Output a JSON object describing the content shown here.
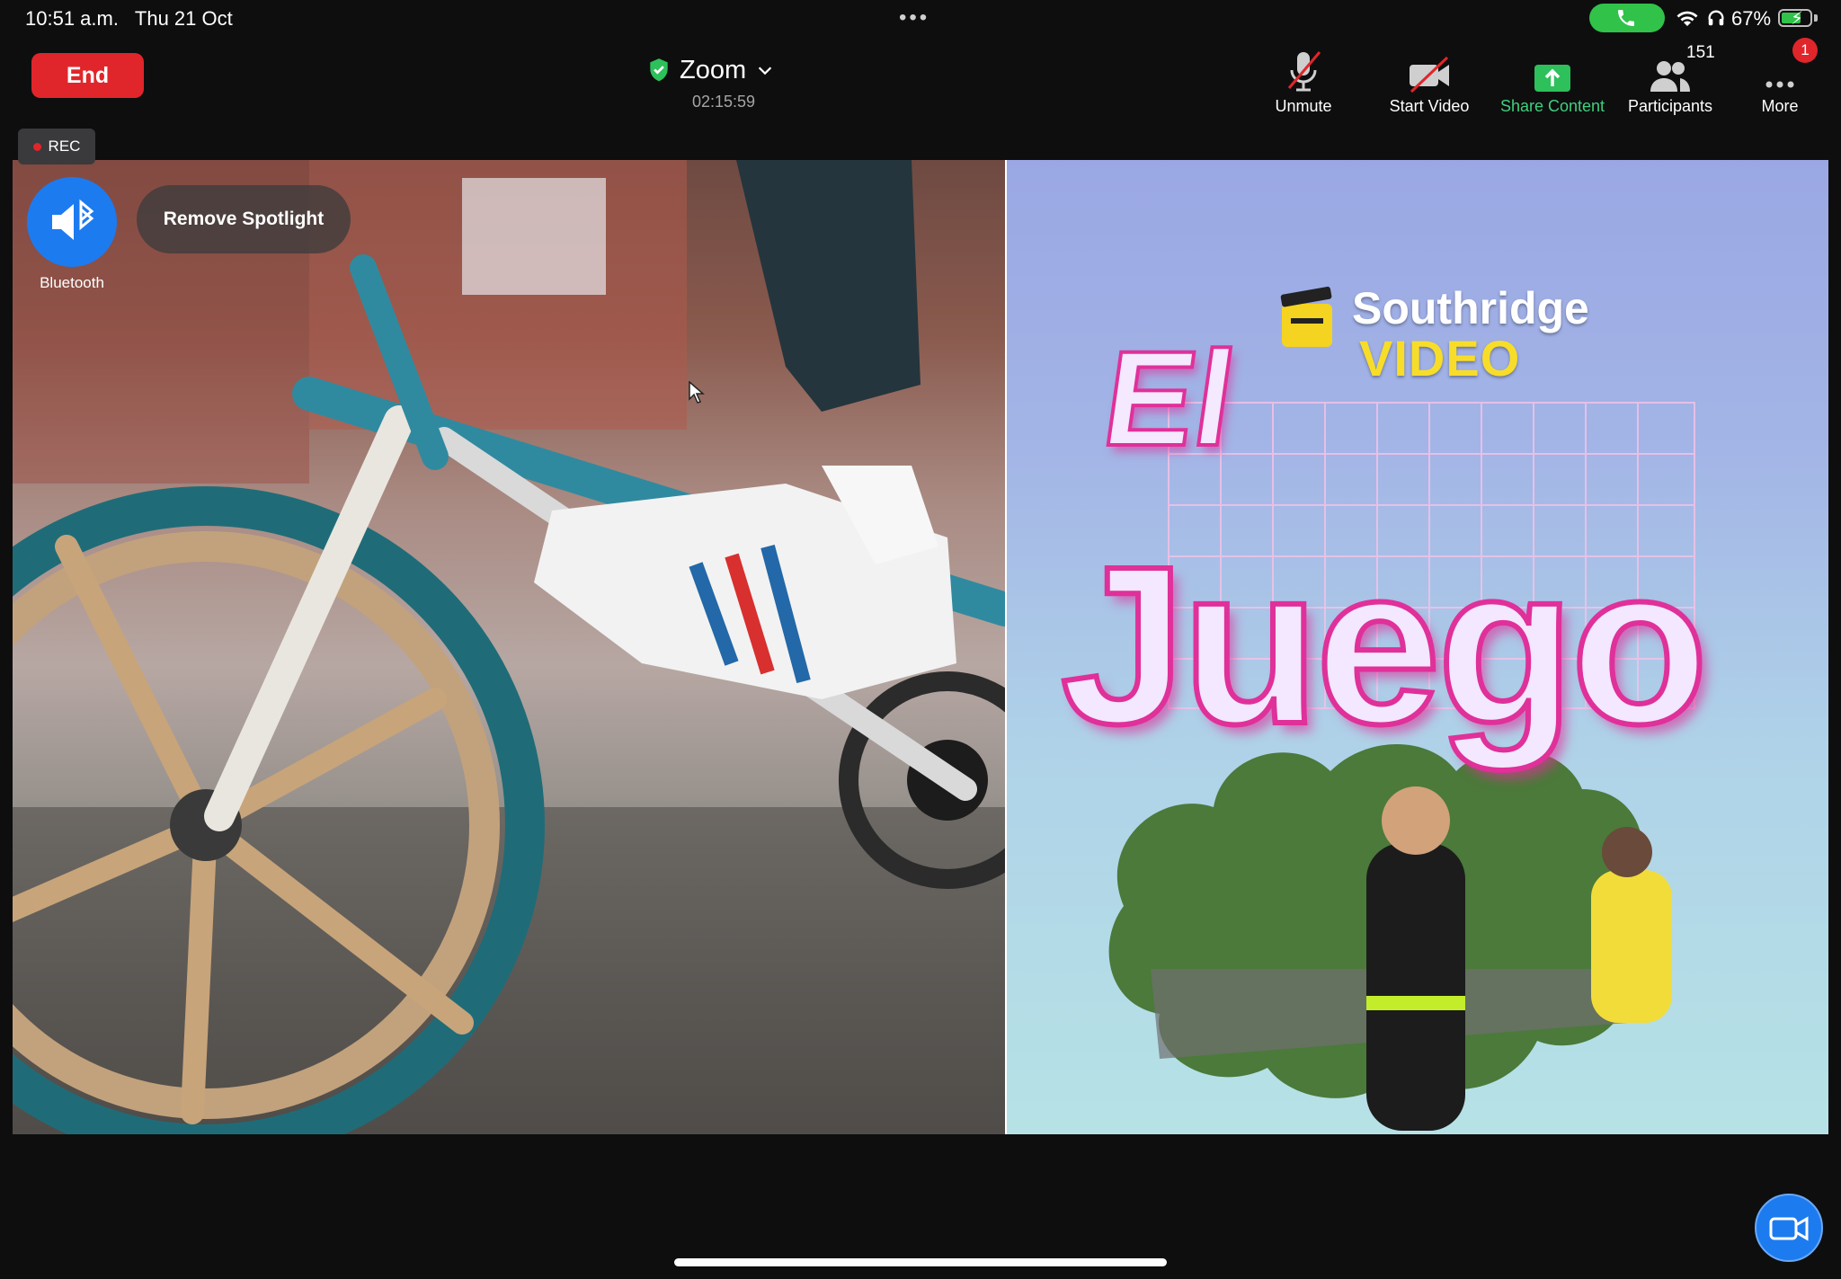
{
  "status_bar": {
    "time": "10:51 a.m.",
    "date": "Thu 21 Oct",
    "battery_percent": "67%",
    "icons": [
      "phone-icon",
      "wifi-icon",
      "headphones-icon",
      "battery-charging-icon"
    ]
  },
  "toolbar": {
    "end_label": "End",
    "meeting_title": "Zoom",
    "timer": "02:15:59",
    "unmute_label": "Unmute",
    "start_video_label": "Start Video",
    "share_content_label": "Share Content",
    "participants_label": "Participants",
    "participants_count": "151",
    "more_label": "More",
    "more_badge": "1"
  },
  "recording": {
    "label": "REC"
  },
  "audio": {
    "bluetooth_label": "Bluetooth"
  },
  "spotlight": {
    "remove_label": "Remove Spotlight"
  },
  "shared_content": {
    "brand_line1": "Southridge",
    "brand_line2": "VIDEO",
    "title_small": "El",
    "title_large": "Juego"
  },
  "colors": {
    "end_red": "#e0262b",
    "share_green": "#3fd07e",
    "accent_blue": "#1d7bf0",
    "title_pink": "#e0309a"
  }
}
